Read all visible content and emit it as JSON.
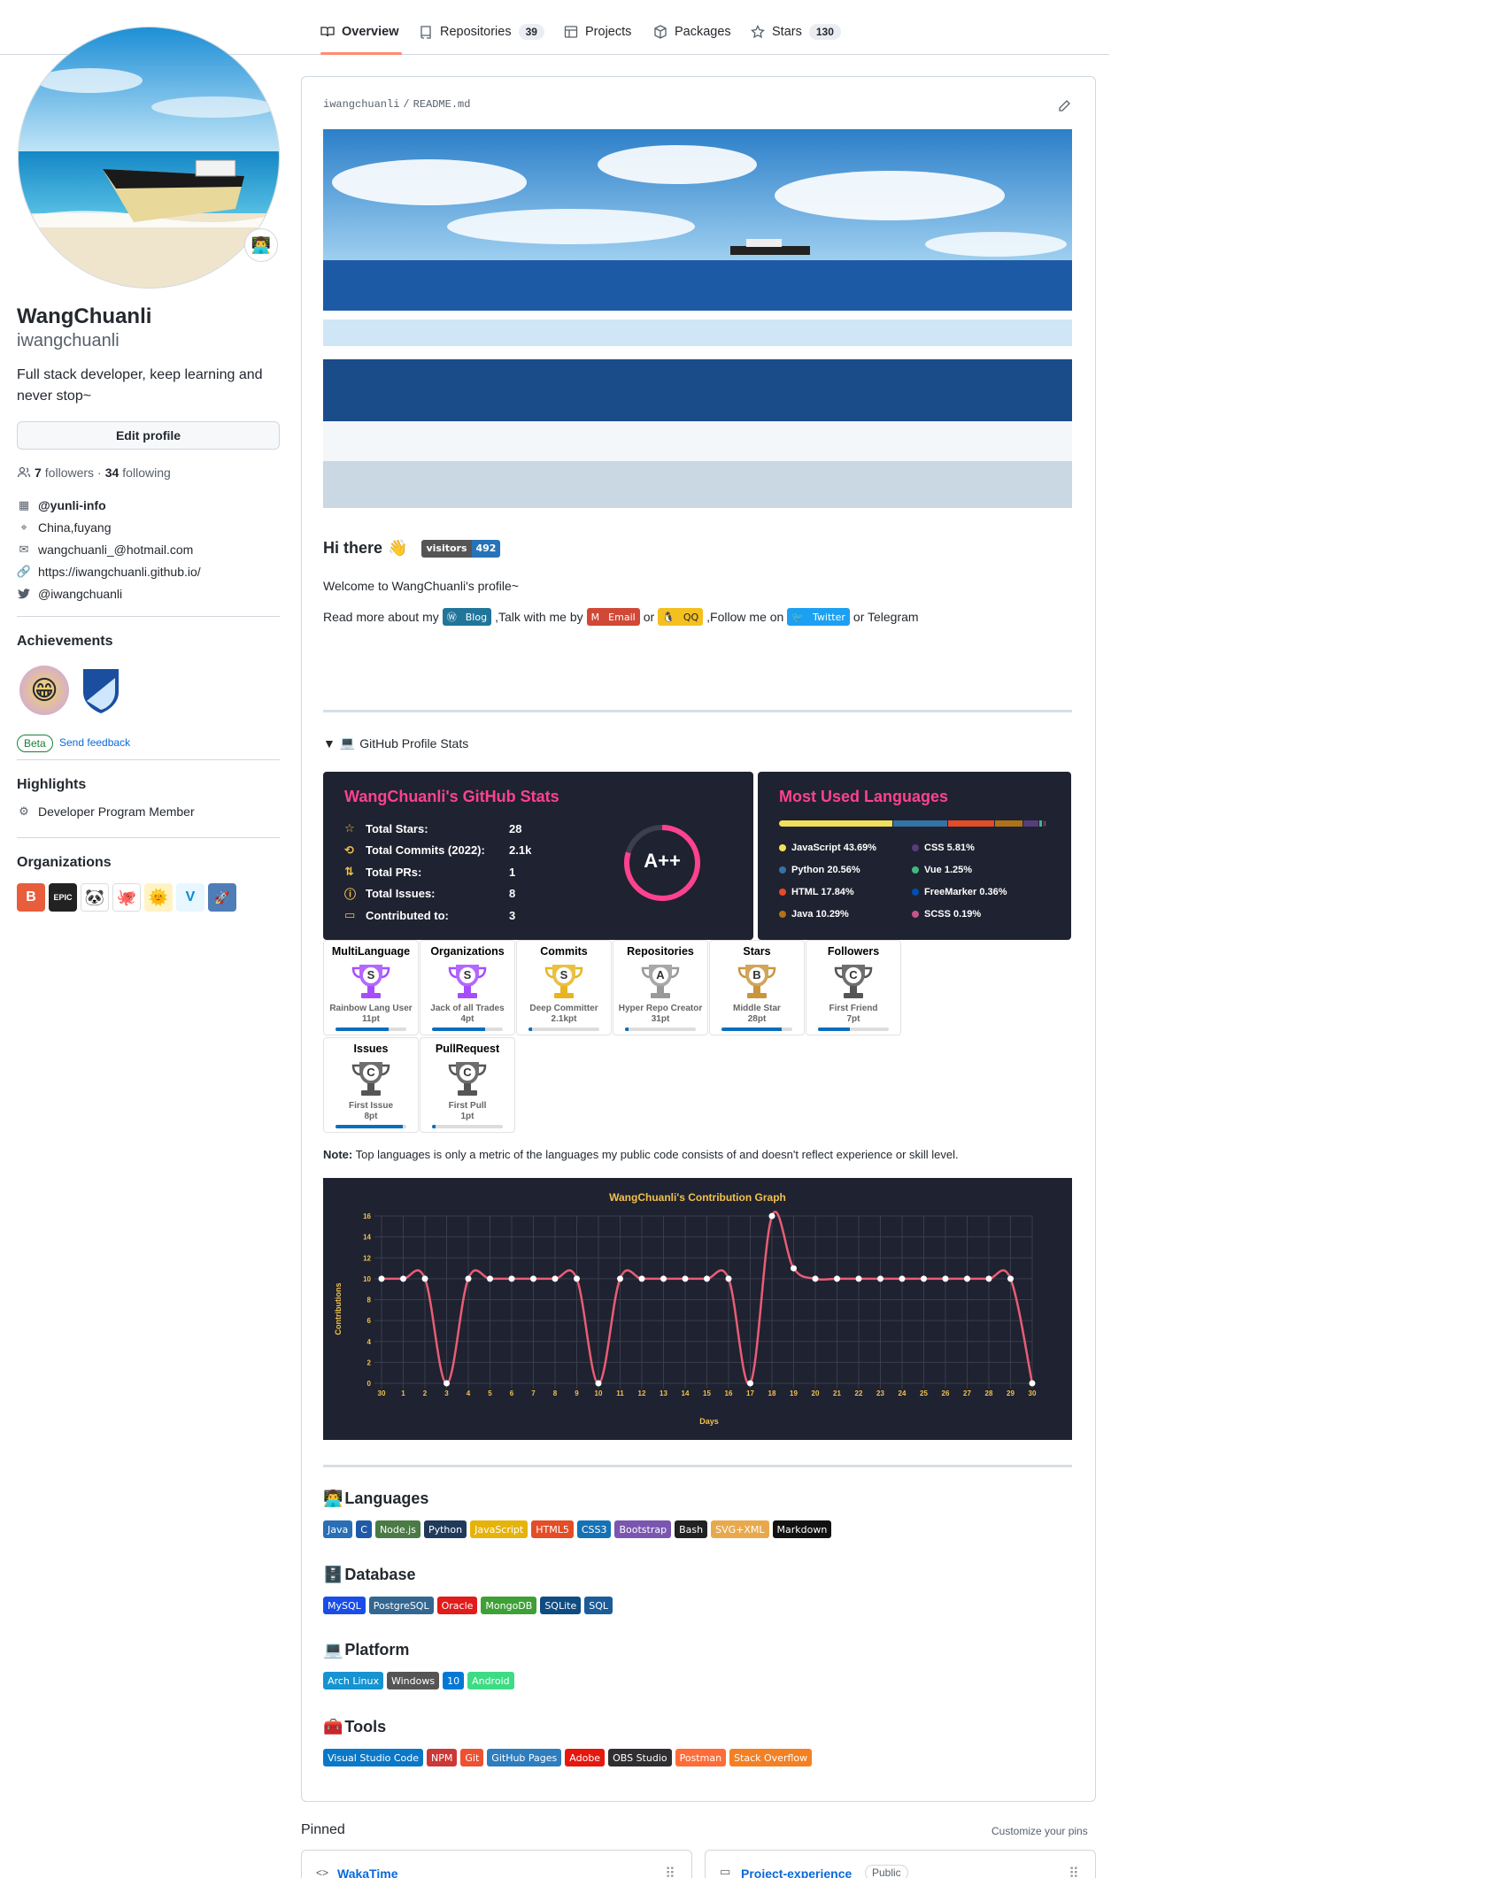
{
  "tabs": [
    {
      "label": "Overview",
      "count": "",
      "icon": "book-icon"
    },
    {
      "label": "Repositories",
      "count": "39",
      "icon": "repo-icon"
    },
    {
      "label": "Projects",
      "count": "",
      "icon": "table-icon"
    },
    {
      "label": "Packages",
      "count": "",
      "icon": "package-icon"
    },
    {
      "label": "Stars",
      "count": "130",
      "icon": "star-icon"
    }
  ],
  "profile": {
    "name": "WangChuanli",
    "login": "iwangchuanli",
    "bio": "Full stack developer, keep learning and never stop~",
    "edit_label": "Edit profile",
    "followers": "7",
    "followers_label": "followers",
    "sep": "·",
    "following": "34",
    "following_label": "following",
    "org": "@yunli-info",
    "location": "China,fuyang",
    "email": "wangchuanli_@hotmail.com",
    "website": "https://iwangchuanli.github.io/",
    "twitter": "@iwangchuanli"
  },
  "sidebar": {
    "achievements_title": "Achievements",
    "beta": "Beta",
    "feedback": "Send feedback",
    "highlights_title": "Highlights",
    "highlight_item": "Developer Program Member",
    "orgs_title": "Organizations"
  },
  "readme": {
    "path_owner": "iwangchuanli",
    "path_sep": "/",
    "path_file": "README.md",
    "hi": "Hi there",
    "visitors_label": "visitors",
    "visitors_count": "492",
    "welcome": "Welcome to WangChuanli's profile~",
    "read_more": "Read more about my",
    "blog": "Blog",
    "talk": ",Talk with me by",
    "email_badge": "Email",
    "or1": "or",
    "qq": "QQ",
    "follow_on": ",Follow me on",
    "twitter_badge": "Twitter",
    "or_telegram": "or Telegram",
    "details": "GitHub Profile Stats",
    "note_bold": "Note:",
    "note": "Top languages is only a metric of the languages my public code consists of and doesn't reflect experience or skill level."
  },
  "stats": {
    "title": "WangChuanli's GitHub Stats",
    "rows": [
      {
        "label": "Total Stars:",
        "value": "28"
      },
      {
        "label": "Total Commits (2022):",
        "value": "2.1k"
      },
      {
        "label": "Total PRs:",
        "value": "1"
      },
      {
        "label": "Total Issues:",
        "value": "8"
      },
      {
        "label": "Contributed to:",
        "value": "3"
      }
    ],
    "grade": "A++"
  },
  "langs": {
    "title": "Most Used Languages",
    "items": [
      {
        "label": "JavaScript 43.69%",
        "color": "#f1e05a",
        "pct": 43.69
      },
      {
        "label": "Python 20.56%",
        "color": "#3572a5",
        "pct": 20.56
      },
      {
        "label": "HTML 17.84%",
        "color": "#e34c26",
        "pct": 17.84
      },
      {
        "label": "Java 10.29%",
        "color": "#b07219",
        "pct": 10.29
      },
      {
        "label": "CSS 5.81%",
        "color": "#563d7c",
        "pct": 5.81
      },
      {
        "label": "Vue 1.25%",
        "color": "#41b883",
        "pct": 1.25
      },
      {
        "label": "FreeMarker 0.36%",
        "color": "#0050b2",
        "pct": 0.36
      },
      {
        "label": "SCSS 0.19%",
        "color": "#c6538c",
        "pct": 0.19
      }
    ]
  },
  "trophies": [
    {
      "title": "MultiLanguage",
      "rank": "S",
      "name": "Rainbow Lang User",
      "pt": "11pt",
      "color": "#a64dff",
      "fill": 0.75
    },
    {
      "title": "Organizations",
      "rank": "S",
      "name": "Jack of all Trades",
      "pt": "4pt",
      "color": "#a64dff",
      "fill": 0.75
    },
    {
      "title": "Commits",
      "rank": "S",
      "name": "Deep Committer",
      "pt": "2.1kpt",
      "color": "#e8b520",
      "fill": 0.05
    },
    {
      "title": "Repositories",
      "rank": "A",
      "name": "Hyper Repo Creator",
      "pt": "31pt",
      "color": "#999",
      "fill": 0.05
    },
    {
      "title": "Stars",
      "rank": "B",
      "name": "Middle Star",
      "pt": "28pt",
      "color": "#c9963c",
      "fill": 0.85
    },
    {
      "title": "Followers",
      "rank": "C",
      "name": "First Friend",
      "pt": "7pt",
      "color": "#555",
      "fill": 0.45
    },
    {
      "title": "Issues",
      "rank": "C",
      "name": "First Issue",
      "pt": "8pt",
      "color": "#555",
      "fill": 0.95
    },
    {
      "title": "PullRequest",
      "rank": "C",
      "name": "First Pull",
      "pt": "1pt",
      "color": "#555",
      "fill": 0.05
    }
  ],
  "chart_data": {
    "type": "line",
    "title": "WangChuanli's Contribution Graph",
    "xlabel": "Days",
    "ylabel": "Contributions",
    "x": [
      "30",
      "1",
      "2",
      "3",
      "4",
      "5",
      "6",
      "7",
      "8",
      "9",
      "10",
      "11",
      "12",
      "13",
      "14",
      "15",
      "16",
      "17",
      "18",
      "19",
      "20",
      "21",
      "22",
      "23",
      "24",
      "25",
      "26",
      "27",
      "28",
      "29",
      "30"
    ],
    "values": [
      10,
      10,
      10,
      0,
      10,
      10,
      10,
      10,
      10,
      10,
      0,
      10,
      10,
      10,
      10,
      10,
      10,
      0,
      16,
      11,
      10,
      10,
      10,
      10,
      10,
      10,
      10,
      10,
      10,
      10,
      0
    ],
    "ylim": [
      0,
      16
    ],
    "yticks": [
      "0",
      "2",
      "4",
      "6",
      "8",
      "10",
      "12",
      "14",
      "16"
    ],
    "line_color": "#e85d75",
    "point_color": "#ffffff",
    "axis_color": "#f2c14e"
  },
  "sections": [
    {
      "icon": "👨‍💻",
      "title": "Languages",
      "badges": [
        {
          "t": "Java",
          "c": "#2a6fb5"
        },
        {
          "t": "C",
          "c": "#1e5aa8"
        },
        {
          "t": "Node.js",
          "c": "#4a7a45"
        },
        {
          "t": "Python",
          "c": "#1f3a5a"
        },
        {
          "t": "JavaScript",
          "c": "#e6b30a"
        },
        {
          "t": "HTML5",
          "c": "#e44d26"
        },
        {
          "t": "CSS3",
          "c": "#1572b6"
        },
        {
          "t": "Bootstrap",
          "c": "#7a56b0"
        },
        {
          "t": "Bash",
          "c": "#222"
        },
        {
          "t": "SVG+XML",
          "c": "#e8a94d"
        },
        {
          "t": "Markdown",
          "c": "#111"
        }
      ]
    },
    {
      "icon": "🗄️",
      "title": "Database",
      "badges": [
        {
          "t": "MySQL",
          "c": "#1a4de8"
        },
        {
          "t": "PostgreSQL",
          "c": "#336791"
        },
        {
          "t": "Oracle",
          "c": "#e21b1b"
        },
        {
          "t": "MongoDB",
          "c": "#3fa037"
        },
        {
          "t": "SQLite",
          "c": "#0f4c81"
        },
        {
          "t": "SQL",
          "c": "#1c5d99"
        }
      ]
    },
    {
      "icon": "💻",
      "title": "Platform",
      "badges": [
        {
          "t": "Arch Linux",
          "c": "#1793d1"
        },
        {
          "t": "Windows",
          "c": "#555"
        },
        {
          "t": "10",
          "c": "#0078d6"
        },
        {
          "t": "Android",
          "c": "#3ddc84"
        }
      ]
    },
    {
      "icon": "🧰",
      "title": "Tools",
      "badges": [
        {
          "t": "Visual Studio Code",
          "c": "#0a78c8"
        },
        {
          "t": "NPM",
          "c": "#cb3837"
        },
        {
          "t": "Git",
          "c": "#f05032"
        },
        {
          "t": "GitHub Pages",
          "c": "#2e7dbf"
        },
        {
          "t": "Adobe",
          "c": "#e6170e"
        },
        {
          "t": "OBS Studio",
          "c": "#302e31"
        },
        {
          "t": "Postman",
          "c": "#ff6c37"
        },
        {
          "t": "Stack Overflow",
          "c": "#f48024"
        }
      ]
    }
  ],
  "pinned": {
    "title": "Pinned",
    "customize": "Customize your pins",
    "items": [
      {
        "name": "WakaTime",
        "badge": ""
      },
      {
        "name": "Project-experience",
        "badge": "Public"
      }
    ]
  }
}
